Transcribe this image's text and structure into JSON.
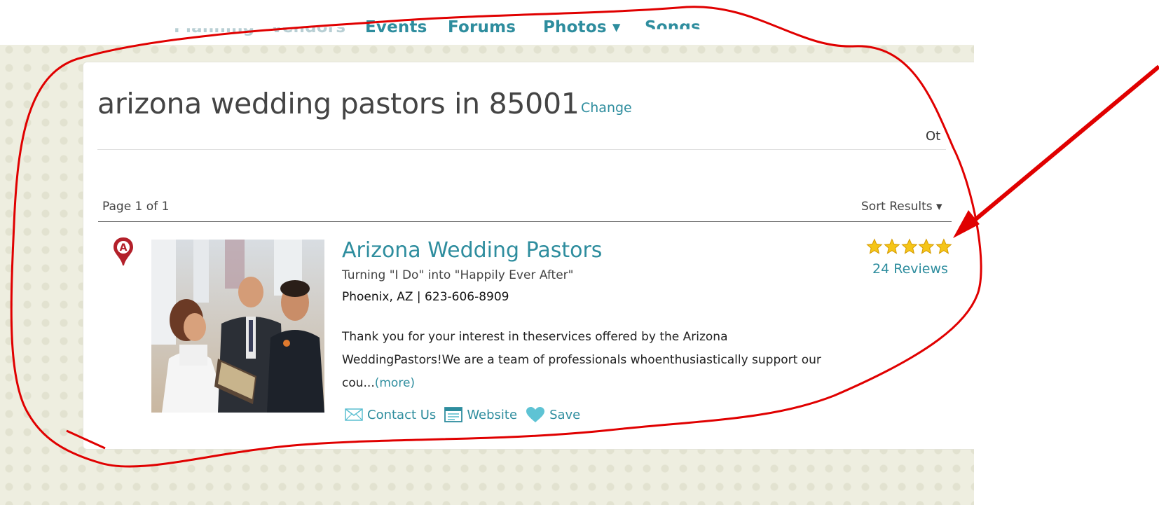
{
  "nav": {
    "items": [
      {
        "label": "Planning",
        "state": "cut-off"
      },
      {
        "label": "Vendors",
        "state": "cut-off"
      },
      {
        "label": "Events"
      },
      {
        "label": "Forums"
      },
      {
        "label": "Photos ▾",
        "has_dropdown": true
      },
      {
        "label": "Songs",
        "state": "cut-off"
      }
    ]
  },
  "search": {
    "title": "arizona wedding pastors in 85001",
    "change_link": "Change",
    "truncated_right_text": "Ot"
  },
  "results": {
    "page_info": "Page 1 of 1",
    "sort_label": "Sort Results ▾",
    "listings": [
      {
        "marker_letter": "A",
        "name": "Arizona Wedding Pastors",
        "tagline": "Turning \"I Do\" into \"Happily Ever After\"",
        "location": "Phoenix, AZ | 623-606-8909",
        "description": "Thank you for your interest in theservices offered by the Arizona WeddingPastors!We are a team of professionals whoenthusiastically support our cou...",
        "more_link": "(more)",
        "rating_stars": 5,
        "reviews_label": "24 Reviews",
        "actions": {
          "contact": "Contact Us",
          "website": "Website",
          "save": "Save"
        },
        "photo_description": "Wedding ceremony photo with bride, officiant and groom"
      }
    ]
  },
  "colors": {
    "link": "#2e8d9e",
    "title_text": "#444444",
    "star_fill": "#f5c518",
    "marker_red": "#b3202a",
    "annotation_red": "#e00000"
  }
}
